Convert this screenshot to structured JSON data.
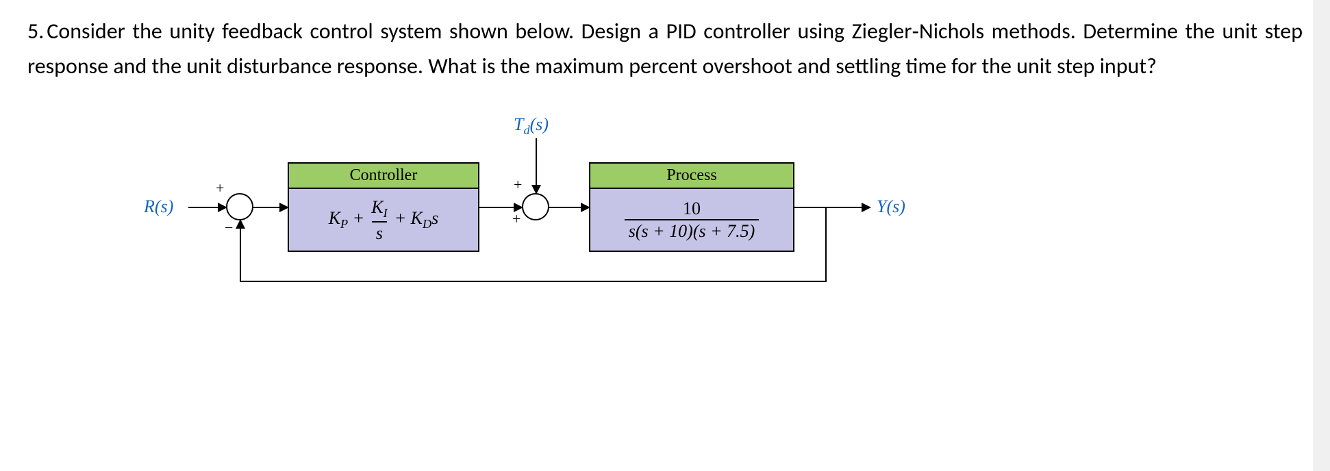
{
  "question": {
    "number": "5.",
    "text": "Consider the unity feedback control system shown below. Design a PID controller using Ziegler‑Nichols methods. Determine the unit step response and the unit disturbance response. What is the maximum percent overshoot and settling time for the unit step input?"
  },
  "diagram": {
    "input_label": "R(s)",
    "disturbance_label": "T_d(s)",
    "output_label": "Y(s)",
    "sum1": {
      "top_sign": "+",
      "bottom_sign": "−"
    },
    "sum2": {
      "top_sign": "+",
      "left_sign": "+"
    },
    "controller": {
      "title": "Controller",
      "expr_parts": {
        "kp": "K_P",
        "plus1": " + ",
        "ki": "K_I",
        "over": "s",
        "plus2": " + ",
        "kd": "K_D",
        "s": "s"
      },
      "expr_text": "K_P + K_I/s + K_D s"
    },
    "process": {
      "title": "Process",
      "numerator": "10",
      "denominator": "s(s + 10)(s + 7.5)",
      "expr_text": "10 / ( s(s+10)(s+7.5) )"
    }
  },
  "chart_data": {
    "type": "block-diagram",
    "nodes": [
      {
        "id": "R",
        "kind": "source",
        "label": "R(s)"
      },
      {
        "id": "S1",
        "kind": "sum",
        "inputs": [
          {
            "from": "R",
            "sign": "+"
          },
          {
            "from": "feedback",
            "sign": "-"
          }
        ]
      },
      {
        "id": "C",
        "kind": "block",
        "title": "Controller",
        "tf": "K_P + K_I/s + K_D*s"
      },
      {
        "id": "Td",
        "kind": "source",
        "label": "T_d(s)"
      },
      {
        "id": "S2",
        "kind": "sum",
        "inputs": [
          {
            "from": "C",
            "sign": "+"
          },
          {
            "from": "Td",
            "sign": "+"
          }
        ]
      },
      {
        "id": "G",
        "kind": "block",
        "title": "Process",
        "tf": "10/(s*(s+10)*(s+7.5))"
      },
      {
        "id": "Y",
        "kind": "sink",
        "label": "Y(s)"
      }
    ],
    "edges": [
      [
        "R",
        "S1"
      ],
      [
        "S1",
        "C"
      ],
      [
        "C",
        "S2"
      ],
      [
        "Td",
        "S2"
      ],
      [
        "S2",
        "G"
      ],
      [
        "G",
        "Y"
      ],
      [
        "Y",
        "S1"
      ]
    ],
    "feedback": "unity"
  }
}
